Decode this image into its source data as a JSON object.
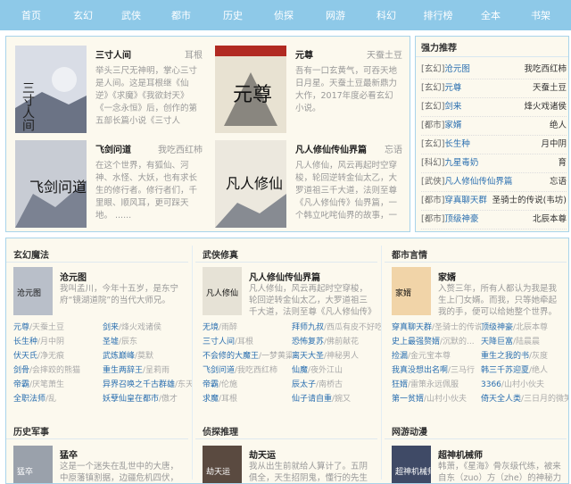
{
  "nav": [
    "首页",
    "玄幻",
    "武侠",
    "都市",
    "历史",
    "侦探",
    "网游",
    "科幻",
    "排行榜",
    "全本",
    "书架"
  ],
  "featured": [
    {
      "title": "三寸人间",
      "author": "耳根",
      "desc": "举头三尺无神明，掌心三寸是人间。这是耳根继《仙逆》《求魔》《我欲封天》《一念永恒》后，创作的第五部长篇小说《三寸人间》。",
      "cover_text": "三寸人间",
      "cover_bg": "#d9dde6"
    },
    {
      "title": "元尊",
      "author": "天蚕土豆",
      "desc": "吾有一口玄黄气，可吞天地日月星。天蚕土豆最新鼎力大作，2017年度必看玄幻小说。",
      "cover_text": "元尊",
      "cover_bg": "#e8e2d2"
    },
    {
      "title": "飞剑问道",
      "author": "我吃西红柿",
      "desc": "在这个世界，有狐仙、河神、水怪、大妖，也有求长生的修行者。修行者们，千里眼、顺风耳，更可踩天地。   ......",
      "cover_text": "飞剑问道",
      "cover_bg": "#c8ccd4"
    },
    {
      "title": "凡人修仙传仙界篇",
      "author": "忘语",
      "desc": "凡人修仙，风云再起时空穿梭，轮回逆转金仙太乙，大罗道祖三千大道，法则至尊《凡人修仙传》仙界篇，一个韩立叱咤仙界的故事，一个凡人小子修仙的不灭传说。",
      "cover_text": "凡人修仙",
      "cover_bg": "#ece8de"
    }
  ],
  "ranking": {
    "title": "强力推荐",
    "items": [
      {
        "tag": "[玄幻]",
        "name": "沧元图",
        "author": "我吃西红柿"
      },
      {
        "tag": "[玄幻]",
        "name": "元尊",
        "author": "天蚕土豆"
      },
      {
        "tag": "[玄幻]",
        "name": "剑来",
        "author": "烽火戏诸侯"
      },
      {
        "tag": "[都市]",
        "name": "家婿",
        "author": "绝人"
      },
      {
        "tag": "[玄幻]",
        "name": "长生种",
        "author": "月中阴"
      },
      {
        "tag": "[科幻]",
        "name": "九星毒奶",
        "author": "育"
      },
      {
        "tag": "[武侠]",
        "name": "凡人修仙传仙界篇",
        "author": "忘语"
      },
      {
        "tag": "[都市]",
        "name": "穿真聊天群",
        "author": "圣骑士的传说(韦坊)"
      },
      {
        "tag": "[都市]",
        "name": "顶级神豪",
        "author": "北辰本尊"
      }
    ]
  },
  "categories": [
    {
      "name": "玄幻魔法",
      "feat": {
        "title": "沧元图",
        "desc": "我叫孟川，今年十五岁，是东宁府“镜湖道院”的当代大师兄。",
        "cover_text": "沧元图",
        "cover_bg": "#b9bfc9"
      },
      "list": [
        {
          "title": "元尊",
          "author": "/天蚕土豆"
        },
        {
          "title": "剑来",
          "author": "/烽火戏诸侯"
        },
        {
          "title": "长生种",
          "author": "/月中阴"
        },
        {
          "title": "圣墟",
          "author": "/辰东"
        },
        {
          "title": "伏天氏",
          "author": "/净无痕"
        },
        {
          "title": "武炼巅峰",
          "author": "/莫默"
        },
        {
          "title": "剑骨",
          "author": "/会摔跤的熊猫"
        },
        {
          "title": "重生两辞王",
          "author": "/呈莉雨"
        },
        {
          "title": "帝霸",
          "author": "/厌笔萧生"
        },
        {
          "title": "异界召唤之千古群雄",
          "author": "/东天"
        },
        {
          "title": "全职法师",
          "author": "/乱"
        },
        {
          "title": "妖孽仙皇在都市",
          "author": "/傲才"
        }
      ]
    },
    {
      "name": "武侠修真",
      "feat": {
        "title": "凡人修仙传仙界篇",
        "desc": "凡人修仙，风云再起时空穿梭，轮回逆转金仙太乙，大罗道祖三千大道，法则至尊《凡人修仙传》仙界",
        "cover_text": "凡人修仙",
        "cover_bg": "#e6e2d6"
      },
      "list": [
        {
          "title": "无境",
          "author": "/雨醉"
        },
        {
          "title": "拜师九叔",
          "author": "/西瓜有皮不好吃"
        },
        {
          "title": "三寸人间",
          "author": "/耳根"
        },
        {
          "title": "恐怖复苏",
          "author": "/佛前献花"
        },
        {
          "title": "不会修的大魔王",
          "author": "/一梦黄粱"
        },
        {
          "title": "离天大圣",
          "author": "/神秘男人"
        },
        {
          "title": "飞剑问道",
          "author": "/我吃西红柿"
        },
        {
          "title": "仙魔",
          "author": "/夜外江山"
        },
        {
          "title": "帝霸",
          "author": "/伦施"
        },
        {
          "title": "辰太子",
          "author": "/南桥古"
        },
        {
          "title": "求魔",
          "author": "/耳根"
        },
        {
          "title": "仙子请自重",
          "author": "/婉又"
        }
      ]
    },
    {
      "name": "都市言情",
      "feat": {
        "title": "家婿",
        "desc": "入赘三年，所有人都认为我是我生上门女婿。而我，只等她牵起我的手，便可以给她整个世界。 新书期",
        "cover_text": "家婿",
        "cover_bg": "#f1d4a8"
      },
      "list": [
        {
          "title": "穿真聊天群",
          "author": "/圣骑士的传说"
        },
        {
          "title": "顶级神豪",
          "author": "/北辰本尊"
        },
        {
          "title": "史上最强赘婿",
          "author": "/沉默的..."
        },
        {
          "title": "天降巨富",
          "author": "/陆晨晨"
        },
        {
          "title": "捡漏",
          "author": "/金元宝本尊"
        },
        {
          "title": "重生之我的书",
          "author": "/灰度"
        },
        {
          "title": "我真没想出名啊",
          "author": "/三马行"
        },
        {
          "title": "韩三千苏迎夏",
          "author": "/绝人"
        },
        {
          "title": "狂婿",
          "author": "/雷策永远佩服"
        },
        {
          "title": "3366",
          "author": "/山村小伙夫"
        },
        {
          "title": "第一贫婿",
          "author": "/山村小伙夫"
        },
        {
          "title": "倚天全人类",
          "author": "/三日月的微笑"
        }
      ]
    },
    {
      "name": "历史军事",
      "feat": {
        "title": "猛卒",
        "desc": "这是一个迷失在乱世中的大唐，中原藩镇割据，边疆危机四伏，内忧",
        "cover_text": "猛卒",
        "cover_bg": "#9aa1ab"
      }
    },
    {
      "name": "侦探推理",
      "feat": {
        "title": "劫天运",
        "desc": "我从出生前就给人算计了。五阴俱全，天生招阴鬼，懂行的先生说我",
        "cover_text": "劫天运",
        "cover_bg": "#5a4a40"
      }
    },
    {
      "name": "网游动漫",
      "feat": {
        "title": "超神机械师",
        "desc": "韩萧，《星海》骨灰级代练，被来自东（zuo）方（zhe）的神秘力量扔",
        "cover_text": "超神机械师",
        "cover_bg": "#3f4a66"
      }
    }
  ]
}
